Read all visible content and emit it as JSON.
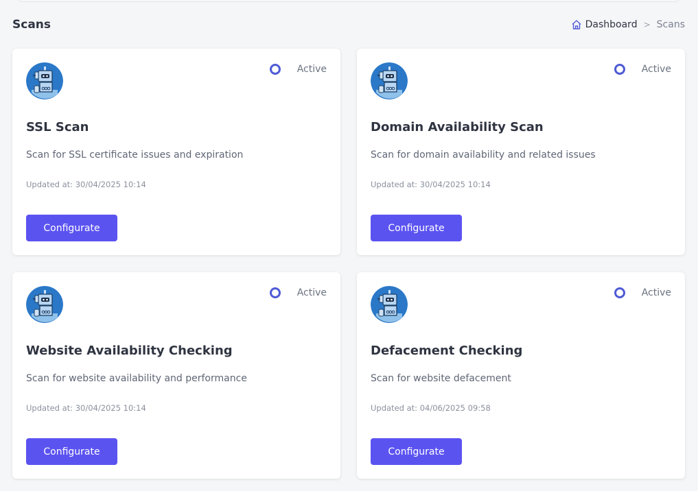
{
  "page": {
    "title": "Scans"
  },
  "breadcrumb": {
    "home_label": "Dashboard",
    "separator": ">",
    "current": "Scans"
  },
  "colors": {
    "accent": "#5b53f0",
    "status_ring": "#4f5bd5"
  },
  "cards": [
    {
      "title": "SSL Scan",
      "description": "Scan for SSL certificate issues and expiration",
      "updated": "Updated at: 30/04/2025 10:14",
      "status": "Active",
      "button_label": "Configurate"
    },
    {
      "title": "Domain Availability Scan",
      "description": "Scan for domain availability and related issues",
      "updated": "Updated at: 30/04/2025 10:14",
      "status": "Active",
      "button_label": "Configurate"
    },
    {
      "title": "Website Availability Checking",
      "description": "Scan for website availability and performance",
      "updated": "Updated at: 30/04/2025 10:14",
      "status": "Active",
      "button_label": "Configurate"
    },
    {
      "title": "Defacement Checking",
      "description": "Scan for website defacement",
      "updated": "Updated at: 04/06/2025 09:58",
      "status": "Active",
      "button_label": "Configurate"
    }
  ]
}
